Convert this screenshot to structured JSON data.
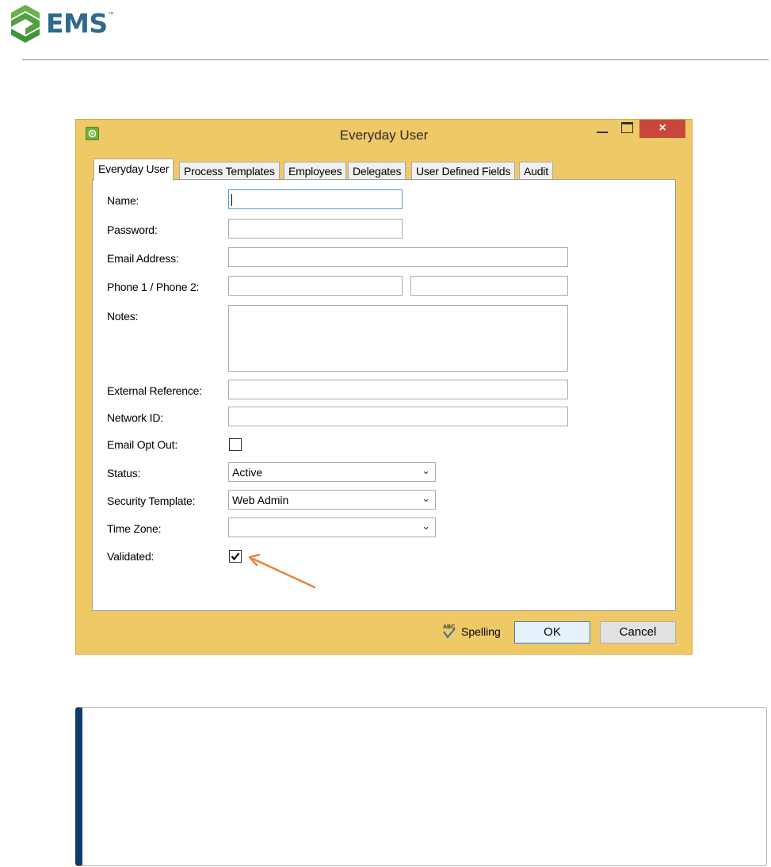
{
  "brand": {
    "name": "EMS",
    "trademark": "™",
    "logo_icon": "ems-chevron-logo"
  },
  "window": {
    "title": "Everyday User",
    "close_glyph": "×",
    "tabs": [
      {
        "label": "Everyday User",
        "active": true
      },
      {
        "label": "Process Templates",
        "active": false
      },
      {
        "label": "Employees",
        "active": false
      },
      {
        "label": "Delegates",
        "active": false
      },
      {
        "label": "User Defined Fields",
        "active": false
      },
      {
        "label": "Audit",
        "active": false
      }
    ]
  },
  "form": {
    "name": {
      "label": "Name:",
      "value": ""
    },
    "password": {
      "label": "Password:",
      "value": ""
    },
    "email": {
      "label": "Email Address:",
      "value": ""
    },
    "phone": {
      "label": "Phone 1 / Phone 2:",
      "phone1": "",
      "phone2": ""
    },
    "notes": {
      "label": "Notes:",
      "value": ""
    },
    "external_reference": {
      "label": "External Reference:",
      "value": ""
    },
    "network_id": {
      "label": "Network ID:",
      "value": ""
    },
    "email_opt_out": {
      "label": "Email Opt Out:",
      "checked": false
    },
    "status": {
      "label": "Status:",
      "value": "Active"
    },
    "security_template": {
      "label": "Security Template:",
      "value": "Web Admin"
    },
    "time_zone": {
      "label": "Time Zone:",
      "value": ""
    },
    "validated": {
      "label": "Validated:",
      "checked": true
    }
  },
  "actions": {
    "spelling": "Spelling",
    "ok": "OK",
    "cancel": "Cancel"
  },
  "colors": {
    "window_frame": "#f0c967",
    "close_button": "#c9463d",
    "brand_blue": "#2c6a8c",
    "brand_green": "#6ab04c",
    "arrow": "#e8843c",
    "note_accent": "#103c6b"
  }
}
